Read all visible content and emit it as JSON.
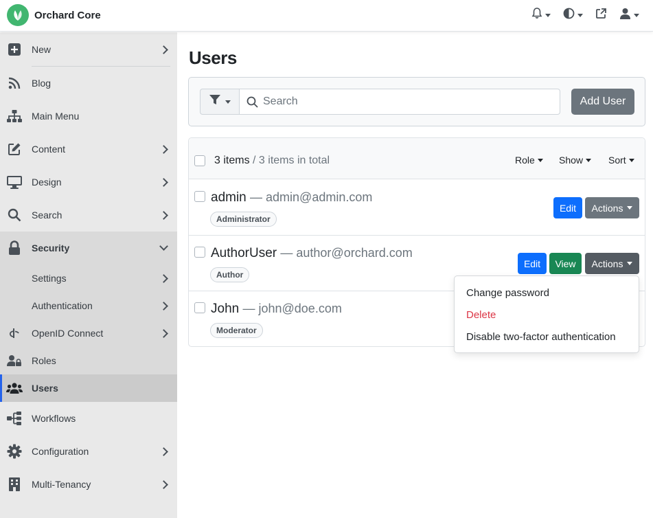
{
  "app": {
    "title": "Orchard Core"
  },
  "sidebar": {
    "items": [
      {
        "label": "New",
        "icon": "plus-square-icon"
      },
      {
        "label": "Blog",
        "icon": "rss-icon"
      },
      {
        "label": "Main Menu",
        "icon": "sitemap-icon"
      },
      {
        "label": "Content",
        "icon": "edit-icon"
      },
      {
        "label": "Design",
        "icon": "desktop-icon"
      },
      {
        "label": "Search",
        "icon": "search-icon"
      },
      {
        "label": "Security",
        "icon": "lock-icon"
      },
      {
        "label": "Settings"
      },
      {
        "label": "Authentication"
      },
      {
        "label": "OpenID Connect",
        "icon": "openid-icon"
      },
      {
        "label": "Roles",
        "icon": "user-lock-icon"
      },
      {
        "label": "Users",
        "icon": "users-icon"
      },
      {
        "label": "Workflows",
        "icon": "workflow-icon"
      },
      {
        "label": "Configuration",
        "icon": "gear-icon"
      },
      {
        "label": "Multi-Tenancy",
        "icon": "building-icon"
      }
    ]
  },
  "main": {
    "title": "Users",
    "search_placeholder": "Search",
    "add_user_label": "Add User",
    "summary": {
      "count": "3 items",
      "total": "/ 3 items in total"
    },
    "filters": [
      "Role",
      "Show",
      "Sort"
    ],
    "users": [
      {
        "name": "admin",
        "email": "— admin@admin.com",
        "role": "Administrator"
      },
      {
        "name": "AuthorUser",
        "email": "— author@orchard.com",
        "role": "Author"
      },
      {
        "name": "John",
        "email": "— john@doe.com",
        "role": "Moderator"
      }
    ],
    "buttons": {
      "edit": "Edit",
      "view": "View",
      "actions": "Actions"
    }
  },
  "actions_menu": {
    "items": [
      "Change password",
      "Delete",
      "Disable two-factor authentication"
    ]
  },
  "colors": {
    "brand": "#41b670",
    "primary": "#0d6efd",
    "success": "#198754",
    "secondary": "#6c757d",
    "danger": "#dc3545",
    "active_indicator": "#2563eb"
  }
}
